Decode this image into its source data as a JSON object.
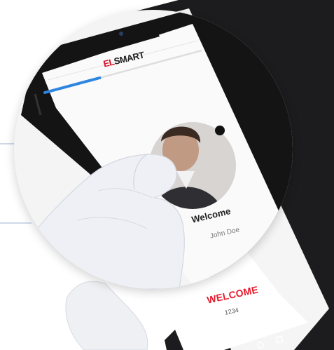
{
  "app": {
    "brand": "ELSMART",
    "brand_mark": "EL",
    "brand_rest": "SMART",
    "accent_color": "#e8192c",
    "progress_color": "#2f86e0"
  },
  "login_screen": {
    "progress_fraction": 0.35,
    "welcome_text": "Welcome",
    "username_text": "John Doe",
    "avatar": "user-photo-avatar"
  },
  "background_screen": {
    "welcome_text": "WELCOME",
    "code_text": "1234"
  },
  "nav_buttons": [
    "back-icon",
    "home-icon",
    "recents-icon"
  ]
}
